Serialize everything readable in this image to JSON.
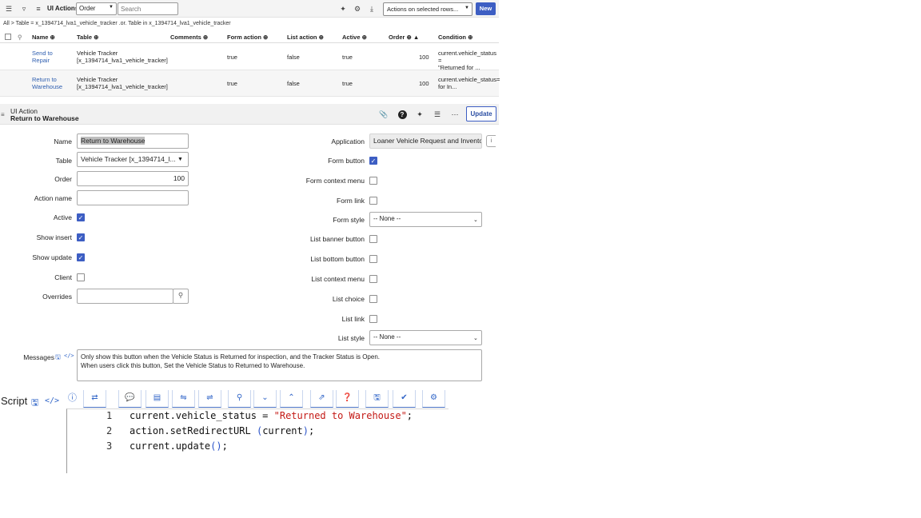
{
  "list": {
    "title": "UI Actions",
    "field_select": "Order",
    "search_placeholder": "Search",
    "actions_select": "Actions on selected rows...",
    "new_label": "New",
    "breadcrumb": "All > Table = x_1394714_lva1_vehicle_tracker .or. Table in x_1394714_lva1_vehicle_tracker",
    "columns": [
      "Name",
      "Table",
      "Comments",
      "Form action",
      "List action",
      "Active",
      "Order",
      "Condition"
    ],
    "rows": [
      {
        "name_line1": "Send to",
        "name_line2": "Repair",
        "table_line1": "Vehicle Tracker",
        "table_line2": "[x_1394714_lva1_vehicle_tracker]",
        "comments": "",
        "form_action": "true",
        "list_action": "false",
        "active": "true",
        "order": "100",
        "condition_line1": "current.vehicle_status =",
        "condition_line2": "\"Returned for ..."
      },
      {
        "name_line1": "Return to",
        "name_line2": "Warehouse",
        "table_line1": "Vehicle Tracker",
        "table_line2": "[x_1394714_lva1_vehicle_tracker]",
        "comments": "",
        "form_action": "true",
        "list_action": "false",
        "active": "true",
        "order": "100",
        "condition_line1": "current.vehicle_status=",
        "condition_line2": "for In..."
      }
    ]
  },
  "form": {
    "type_label": "UI Action",
    "record_title": "Return to Warehouse",
    "update_label": "Update",
    "left_fields": {
      "name_label": "Name",
      "name_value": "Return to Warehouse",
      "table_label": "Table",
      "table_value": "Vehicle Tracker [x_1394714_l...",
      "order_label": "Order",
      "order_value": "100",
      "action_name_label": "Action name",
      "action_name_value": "",
      "active_label": "Active",
      "show_insert_label": "Show insert",
      "show_update_label": "Show update",
      "client_label": "Client",
      "overrides_label": "Overrides"
    },
    "right_fields": {
      "application_label": "Application",
      "application_value": "Loaner Vehicle Request and Invento",
      "form_button_label": "Form button",
      "form_context_menu_label": "Form context menu",
      "form_link_label": "Form link",
      "form_style_label": "Form style",
      "form_style_value": "-- None --",
      "list_banner_button_label": "List banner button",
      "list_bottom_button_label": "List bottom button",
      "list_context_menu_label": "List context menu",
      "list_choice_label": "List choice",
      "list_link_label": "List link",
      "list_style_label": "List style",
      "list_style_value": "-- None --"
    },
    "checkboxes": {
      "active": true,
      "show_insert": true,
      "show_update": true,
      "client": false,
      "form_button": true,
      "form_context_menu": false,
      "form_link": false,
      "list_banner_button": false,
      "list_bottom_button": false,
      "list_context_menu": false,
      "list_choice": false,
      "list_link": false
    },
    "messages_label": "Messages",
    "messages_line1": "Only show this button when the Vehicle Status is Returned for inspection, and the Tracker Status is Open.",
    "messages_line2": "When users click this button, Set the Vehicle Status to Returned to Warehouse.",
    "script_label": "Script",
    "script": {
      "line_numbers": [
        "1",
        "2",
        "3"
      ],
      "line1_pre": "current.vehicle_status = ",
      "line1_str": "\"Returned to Warehouse\"",
      "line1_post": ";",
      "line2_pre": "action.setRedirectURL ",
      "line2_paren_open": "(",
      "line2_arg": "current",
      "line2_paren_close": ")",
      "line2_post": ";",
      "line3_pre": "current.update",
      "line3_parens": "()",
      "line3_post": ";"
    }
  },
  "colors": {
    "accent": "#3d5ec3",
    "link": "#2f5fb0",
    "code_string": "#c41a16"
  }
}
